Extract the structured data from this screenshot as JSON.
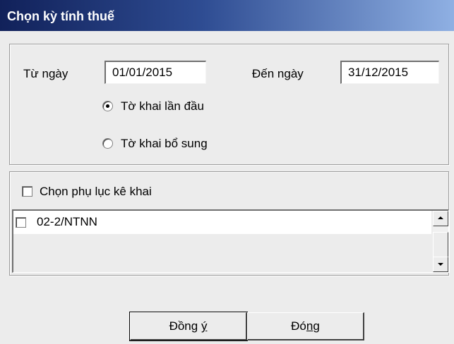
{
  "window": {
    "title": "Chọn kỳ tính thuế"
  },
  "period": {
    "from_label": "Từ ngày",
    "from_value": "01/01/2015",
    "to_label": "Đến ngày",
    "to_value": "31/12/2015"
  },
  "declaration_type": {
    "options": [
      {
        "label": "Tờ khai lần đầu",
        "selected": true
      },
      {
        "label": "Tờ khai bổ sung",
        "selected": false
      }
    ]
  },
  "appendix": {
    "checkbox_label": "Chọn phụ lục kê khai",
    "checked": false,
    "items": [
      {
        "label": "02-2/NTNN",
        "checked": false
      }
    ]
  },
  "buttons": {
    "ok_pre": "Đồng ",
    "ok_mnemonic": "ý",
    "close_pre": "Đó",
    "close_mnemonic": "n",
    "close_post": "g"
  },
  "icons": {
    "scroll_up": "arrow-up-icon",
    "scroll_down": "arrow-down-icon"
  }
}
